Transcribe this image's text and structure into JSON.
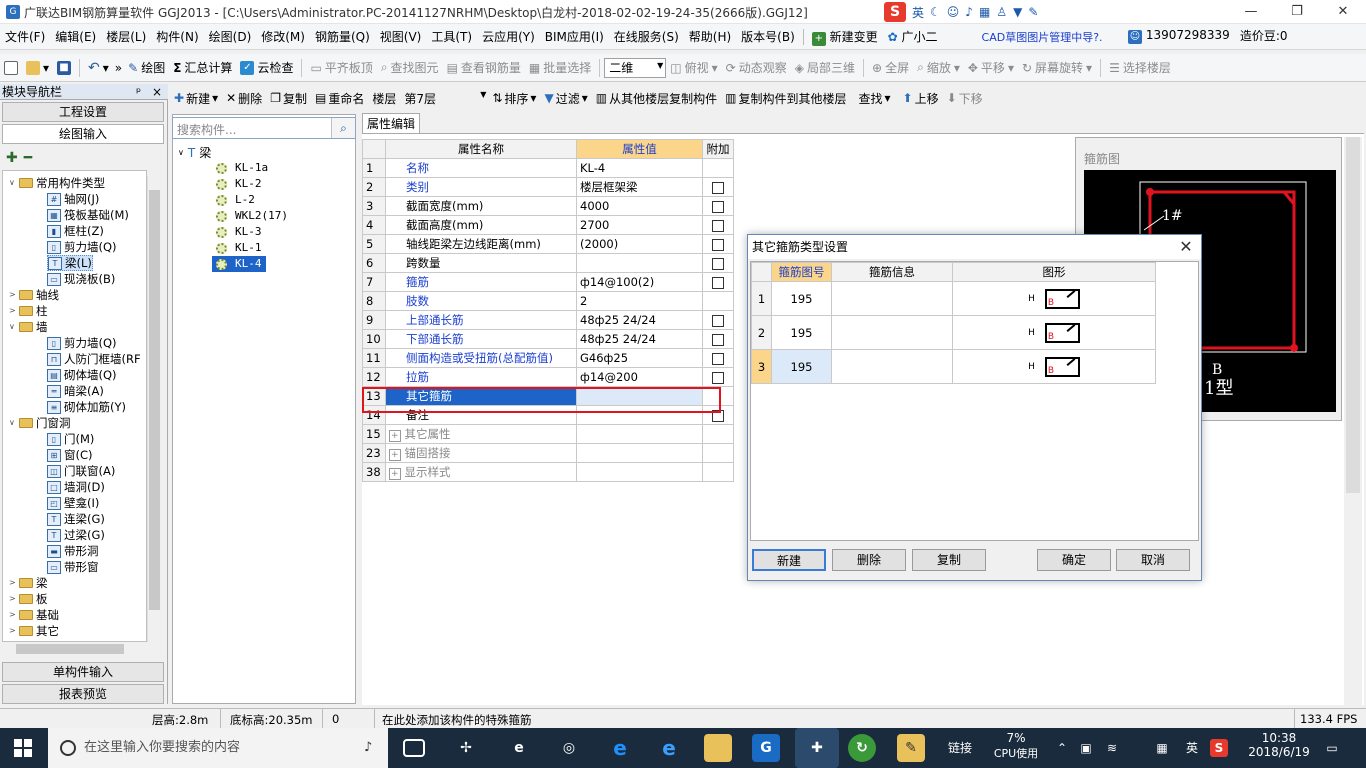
{
  "window": {
    "title": "广联达BIM钢筋算量软件 GGJ2013 - [C:\\Users\\Administrator.PC-20141127NRHM\\Desktop\\白龙村-2018-02-02-19-24-35(2666版).GGJ12]",
    "ime": {
      "logo": "S",
      "lang": "英",
      "icons": [
        "moon-icon",
        "smile-icon",
        "mic-icon",
        "keyboard-icon",
        "person-icon",
        "shirt-icon",
        "wrench-icon"
      ]
    },
    "controls": {
      "minimize": "—",
      "restore": "❐",
      "close": "✕"
    }
  },
  "menu": [
    "文件(F)",
    "编辑(E)",
    "楼层(L)",
    "构件(N)",
    "绘图(D)",
    "修改(M)",
    "钢筋量(Q)",
    "视图(V)",
    "工具(T)",
    "云应用(Y)",
    "BIM应用(I)",
    "在线服务(S)",
    "帮助(H)",
    "版本号(B)"
  ],
  "menu_extra": {
    "new_change": "新建变更",
    "assistant": "广小二",
    "cad_notice": "CAD草图图片管理中导?.",
    "phone": "13907298339",
    "price": "造价豆:0"
  },
  "toolbar1": {
    "draw": "绘图",
    "sum": "汇总计算",
    "cloud_check": "云检查",
    "flat_top": "平齐板顶",
    "find_elem": "查找图元",
    "view_rebar": "查看钢筋量",
    "batch_select": "批量选择",
    "view_mode": "二维",
    "top_view": "俯视",
    "dynamic_view": "动态观察",
    "local_3d": "局部三维",
    "fullscreen": "全屏",
    "zoom": "缩放",
    "pan": "平移",
    "screen_rotate": "屏幕旋转",
    "select_floor": "选择楼层"
  },
  "toolbar2": {
    "new": "新建",
    "delete": "删除",
    "copy": "复制",
    "rename": "重命名",
    "floor_label": "楼层",
    "floor_value": "第7层",
    "sort": "排序",
    "filter": "过滤",
    "copy_from": "从其他楼层复制构件",
    "copy_to": "复制构件到其他楼层",
    "find": "查找",
    "up": "上移",
    "down": "下移"
  },
  "left": {
    "header": "模块导航栏",
    "pin": "ᵖ",
    "close": "×",
    "project_settings": "工程设置",
    "drawing_input": "绘图输入",
    "tree": [
      {
        "label": "常用构件类型",
        "level": 0,
        "type": "folder",
        "toggle": "∨"
      },
      {
        "label": "轴网(J)",
        "level": 1,
        "icon": "grid-icon"
      },
      {
        "label": "筏板基础(M)",
        "level": 1,
        "icon": "raft-icon"
      },
      {
        "label": "框柱(Z)",
        "level": 1,
        "icon": "column-icon"
      },
      {
        "label": "剪力墙(Q)",
        "level": 1,
        "icon": "shear-wall-icon"
      },
      {
        "label": "梁(L)",
        "level": 1,
        "icon": "beam-icon",
        "selected": true
      },
      {
        "label": "现浇板(B)",
        "level": 1,
        "icon": "slab-icon"
      },
      {
        "label": "轴线",
        "level": 0,
        "type": "folder",
        "toggle": ">"
      },
      {
        "label": "柱",
        "level": 0,
        "type": "folder",
        "toggle": ">"
      },
      {
        "label": "墙",
        "level": 0,
        "type": "folder",
        "toggle": "∨"
      },
      {
        "label": "剪力墙(Q)",
        "level": 1,
        "icon": "shear-wall-icon"
      },
      {
        "label": "人防门框墙(RF",
        "level": 1,
        "icon": "door-frame-icon"
      },
      {
        "label": "砌体墙(Q)",
        "level": 1,
        "icon": "masonry-icon"
      },
      {
        "label": "暗梁(A)",
        "level": 1,
        "icon": "hidden-beam-icon"
      },
      {
        "label": "砌体加筋(Y)",
        "level": 1,
        "icon": "masonry-rebar-icon"
      },
      {
        "label": "门窗洞",
        "level": 0,
        "type": "folder",
        "toggle": "∨"
      },
      {
        "label": "门(M)",
        "level": 1,
        "icon": "door-icon"
      },
      {
        "label": "窗(C)",
        "level": 1,
        "icon": "window-icon"
      },
      {
        "label": "门联窗(A)",
        "level": 1,
        "icon": "door-window-icon"
      },
      {
        "label": "墙洞(D)",
        "level": 1,
        "icon": "wall-hole-icon"
      },
      {
        "label": "壁龛(I)",
        "level": 1,
        "icon": "niche-icon"
      },
      {
        "label": "连梁(G)",
        "level": 1,
        "icon": "link-beam-icon"
      },
      {
        "label": "过梁(G)",
        "level": 1,
        "icon": "lintel-icon"
      },
      {
        "label": "带形洞",
        "level": 1,
        "icon": "strip-hole-icon"
      },
      {
        "label": "带形窗",
        "level": 1,
        "icon": "strip-window-icon"
      },
      {
        "label": "梁",
        "level": 0,
        "type": "folder",
        "toggle": ">"
      },
      {
        "label": "板",
        "level": 0,
        "type": "folder",
        "toggle": ">"
      },
      {
        "label": "基础",
        "level": 0,
        "type": "folder",
        "toggle": ">"
      },
      {
        "label": "其它",
        "level": 0,
        "type": "folder",
        "toggle": ">"
      }
    ],
    "single_input": "单构件输入",
    "report_preview": "报表预览"
  },
  "middle": {
    "search_placeholder": "搜索构件...",
    "root": "梁",
    "components": [
      "KL-1a",
      "KL-2",
      "L-2",
      "WKL2(17)",
      "KL-3",
      "KL-1",
      "KL-4"
    ],
    "selected": "KL-4"
  },
  "props": {
    "tab": "属性编辑",
    "headers": [
      "属性名称",
      "属性值",
      "附加"
    ],
    "rows": [
      {
        "n": "1",
        "name": "名称",
        "value": "KL-4",
        "chk": false,
        "blue": true
      },
      {
        "n": "2",
        "name": "类别",
        "value": "楼层框架梁",
        "chk": true,
        "blue": true
      },
      {
        "n": "3",
        "name": "截面宽度(mm)",
        "value": "4000",
        "chk": true,
        "blue": false
      },
      {
        "n": "4",
        "name": "截面高度(mm)",
        "value": "2700",
        "chk": true,
        "blue": false
      },
      {
        "n": "5",
        "name": "轴线距梁左边线距离(mm)",
        "value": "(2000)",
        "chk": true,
        "blue": false
      },
      {
        "n": "6",
        "name": "跨数量",
        "value": "",
        "chk": true,
        "blue": false
      },
      {
        "n": "7",
        "name": "箍筋",
        "value": "ф14@100(2)",
        "chk": true,
        "blue": true
      },
      {
        "n": "8",
        "name": "肢数",
        "value": "2",
        "chk": false,
        "blue": true
      },
      {
        "n": "9",
        "name": "上部通长筋",
        "value": "48ф25 24/24",
        "chk": true,
        "blue": true
      },
      {
        "n": "10",
        "name": "下部通长筋",
        "value": "48ф25 24/24",
        "chk": true,
        "blue": true
      },
      {
        "n": "11",
        "name": "侧面构造或受扭筋(总配筋值)",
        "value": "G46ф25",
        "chk": true,
        "blue": true
      },
      {
        "n": "12",
        "name": "拉筋",
        "value": "ф14@200",
        "chk": true,
        "blue": true
      },
      {
        "n": "13",
        "name": "其它箍筋",
        "value": "",
        "chk": false,
        "blue": false,
        "selected": true
      },
      {
        "n": "14",
        "name": "备注",
        "value": "",
        "chk": true,
        "blue": false
      },
      {
        "n": "15",
        "name": "其它属性",
        "value": "",
        "chk": false,
        "blue": false,
        "group": true
      },
      {
        "n": "23",
        "name": "锚固搭接",
        "value": "",
        "chk": false,
        "blue": false,
        "group": true
      },
      {
        "n": "38",
        "name": "显示样式",
        "value": "",
        "chk": false,
        "blue": false,
        "group": true
      }
    ]
  },
  "stirrup": {
    "label": "箍筋图",
    "tag": "1#",
    "b_label": "B",
    "type_label": "1型"
  },
  "dialog": {
    "title": "其它箍筋类型设置",
    "headers": [
      "箍筋图号",
      "箍筋信息",
      "图形"
    ],
    "rows": [
      {
        "n": "1",
        "code": "195",
        "info": "",
        "h": "H",
        "b": "B"
      },
      {
        "n": "2",
        "code": "195",
        "info": "",
        "h": "H",
        "b": "B"
      },
      {
        "n": "3",
        "code": "195",
        "info": "",
        "h": "H",
        "b": "B"
      }
    ],
    "buttons": {
      "new": "新建",
      "delete": "删除",
      "copy": "复制",
      "ok": "确定",
      "cancel": "取消"
    }
  },
  "status": {
    "floor_height": "层高:2.8m",
    "base_height": "底标高:20.35m",
    "value": "0",
    "hint": "在此处添加该构件的特殊箍筋",
    "fps": "133.4 FPS"
  },
  "taskbar": {
    "search_placeholder": "在这里输入你要搜索的内容",
    "tray": {
      "link": "链接",
      "cpu_pct": "7%",
      "cpu_label": "CPU使用",
      "lang": "英",
      "time": "10:38",
      "date": "2018/6/19"
    }
  }
}
